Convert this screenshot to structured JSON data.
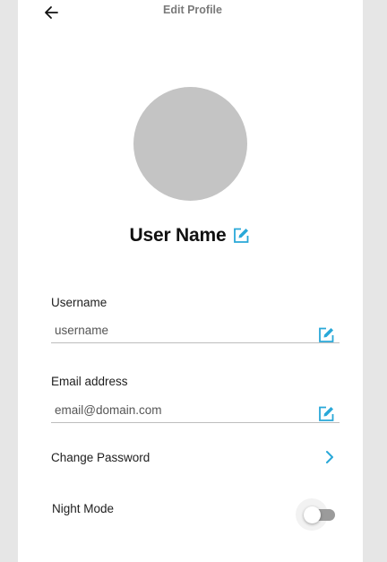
{
  "header": {
    "title": "Edit Profile",
    "back_icon": "arrow-left-icon"
  },
  "profile": {
    "avatar_color": "#c4c4c4",
    "name": "User Name",
    "edit_icon": "edit-icon"
  },
  "fields": {
    "username": {
      "label": "Username",
      "placeholder": "username",
      "value": ""
    },
    "email": {
      "label": "Email address",
      "placeholder": "email@domain.com",
      "value": ""
    }
  },
  "settings": {
    "change_password": {
      "label": "Change Password",
      "icon": "chevron-right-icon"
    },
    "night_mode": {
      "label": "Night Mode",
      "enabled": false
    }
  },
  "colors": {
    "accent": "#29a8d8",
    "background": "#e6e6e6",
    "panel": "#ffffff"
  }
}
